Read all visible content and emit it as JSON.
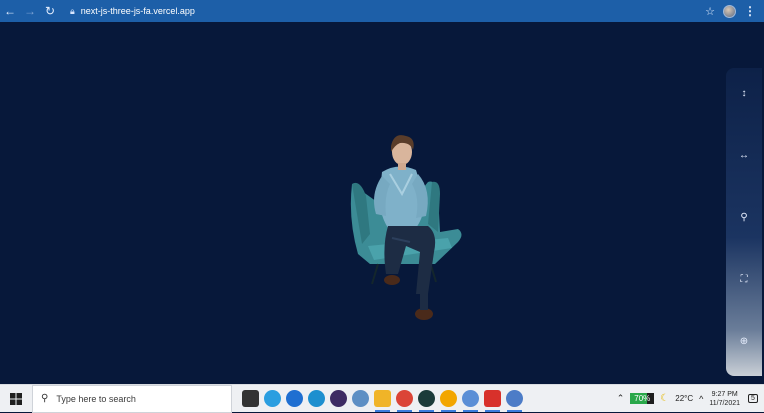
{
  "browser": {
    "back_icon": "back-arrow-icon",
    "forward_icon": "forward-arrow-icon",
    "reload_icon": "reload-icon",
    "url": "next-js-three-js-fa.vercel.app"
  },
  "side_panel": {
    "tools": [
      {
        "icon": "vertical-arrows-icon",
        "glyph": "↕"
      },
      {
        "icon": "horizontal-arrows-icon",
        "glyph": "↔"
      },
      {
        "icon": "search-icon",
        "glyph": "⚲"
      },
      {
        "icon": "fullscreen-icon",
        "glyph": "⛶"
      },
      {
        "icon": "globe-icon",
        "glyph": "⊕"
      }
    ]
  },
  "taskbar": {
    "search_placeholder": "Type here to search",
    "apps": [
      {
        "name": "task-view",
        "color": "#333333"
      },
      {
        "name": "telegram",
        "color": "#2a9ee0"
      },
      {
        "name": "mail",
        "color": "#1f6fd1"
      },
      {
        "name": "edge",
        "color": "#1d8fcf"
      },
      {
        "name": "lens",
        "color": "#3d2b63"
      },
      {
        "name": "notes",
        "color": "#5d8fc4"
      },
      {
        "name": "file-explorer",
        "color": "#f0b428"
      },
      {
        "name": "chrome",
        "color": "#db4437"
      },
      {
        "name": "lens-2",
        "color": "#1b3b3a"
      },
      {
        "name": "chrome-canary",
        "color": "#f2a600"
      },
      {
        "name": "chrome-user",
        "color": "#5b8fd6"
      },
      {
        "name": "red-app",
        "color": "#d8312b"
      },
      {
        "name": "chrome-active",
        "color": "#4c7cc7"
      }
    ],
    "battery_percent": "70%",
    "battery_level": 0.7,
    "temperature": "22°C",
    "time": "9:27 PM",
    "date": "11/7/2021",
    "notification_count": "5"
  }
}
